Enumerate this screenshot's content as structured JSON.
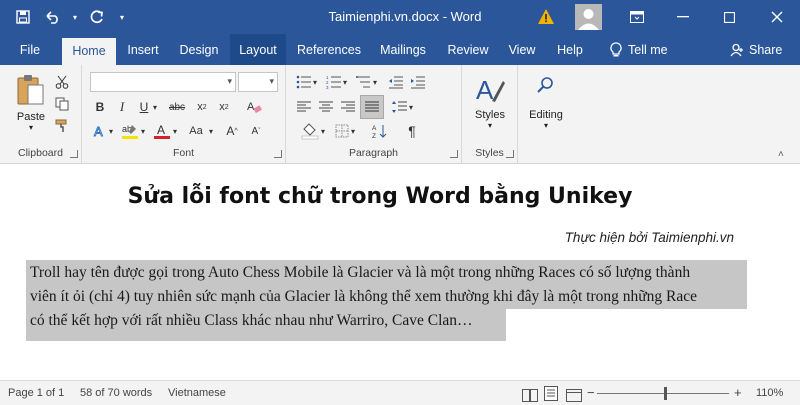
{
  "window": {
    "document_title": "Taimienphi.vn.docx - Word"
  },
  "tabs": [
    {
      "label": "File"
    },
    {
      "label": "Home"
    },
    {
      "label": "Insert"
    },
    {
      "label": "Design"
    },
    {
      "label": "Layout"
    },
    {
      "label": "References"
    },
    {
      "label": "Mailings"
    },
    {
      "label": "Review"
    },
    {
      "label": "View"
    },
    {
      "label": "Help"
    }
  ],
  "tell_me": "Tell me",
  "share": "Share",
  "ribbon": {
    "clipboard": {
      "label": "Clipboard",
      "paste_label": "Paste"
    },
    "font": {
      "label": "Font",
      "font_name": "",
      "font_size": ""
    },
    "paragraph": {
      "label": "Paragraph"
    },
    "styles": {
      "label": "Styles",
      "styles_button": "Styles"
    },
    "editing": {
      "editing_button": "Editing"
    }
  },
  "document": {
    "heading": "Sửa lỗi font chữ trong Word bằng Unikey",
    "credit": "Thực hiện bởi Taimienphi.vn",
    "paragraph_lines": [
      "Troll hay tên được gọi trong Auto Chess Mobile là Glacier và là một trong những Races có số lượng thành",
      "viên ít ỏi (chỉ 4) tuy nhiên sức mạnh của Glacier là không thể xem thường khi đây là một trong những Race",
      "có thể kết hợp với rất nhiều Class khác nhau như Warriro, Cave Clan…"
    ]
  },
  "status": {
    "page": "Page 1 of 1",
    "words": "58 of 70 words",
    "language": "Vietnamese",
    "zoom_percent": "110%",
    "zoom_value": 110
  },
  "colors": {
    "accent": "#2b579a",
    "ribbon_bg": "#f3f3f3",
    "selection": "#c6c6c6",
    "warning": "#f0b400"
  }
}
